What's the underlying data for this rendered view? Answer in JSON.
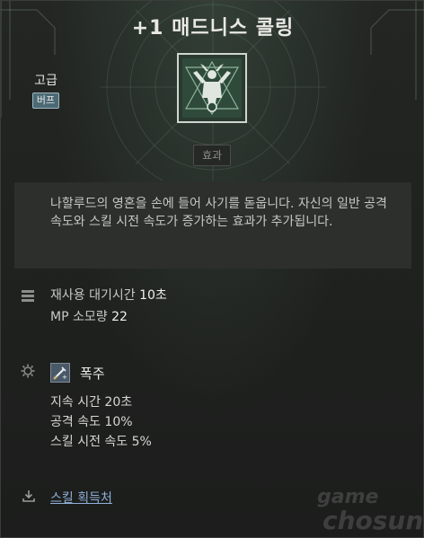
{
  "header": {
    "title": "+1 매드니스 콜링",
    "grade": "고급",
    "type_badge": "버프"
  },
  "tabs": {
    "effect_label": "효과"
  },
  "description": "나할루드의 영혼을 손에 들어 사기를 돋웁니다. 자신의 일반 공격 속도와 스킬 시전 속도가 증가하는 효과가 추가됩니다.",
  "cost": {
    "cooldown_label": "재사용 대기시간",
    "cooldown_value": "10초",
    "mp_label": "MP 소모량",
    "mp_value": "22"
  },
  "buff": {
    "name": "폭주",
    "rows": [
      "지속 시간 20초",
      "공격 속도 10%",
      "스킬 시전 속도 5%"
    ]
  },
  "footer": {
    "acquire_link": "스킬 획득처"
  },
  "watermark": {
    "line1": "game",
    "line2": "chosun"
  },
  "colors": {
    "background": "#1f211f",
    "badge": "#4b6a75",
    "link": "#8fb0d8",
    "icon_frame": "#cfd6cf"
  },
  "icons": {
    "skill": "skill-icon",
    "cost": "stack-icon",
    "buff": "gear-icon",
    "acquire": "download-icon"
  }
}
